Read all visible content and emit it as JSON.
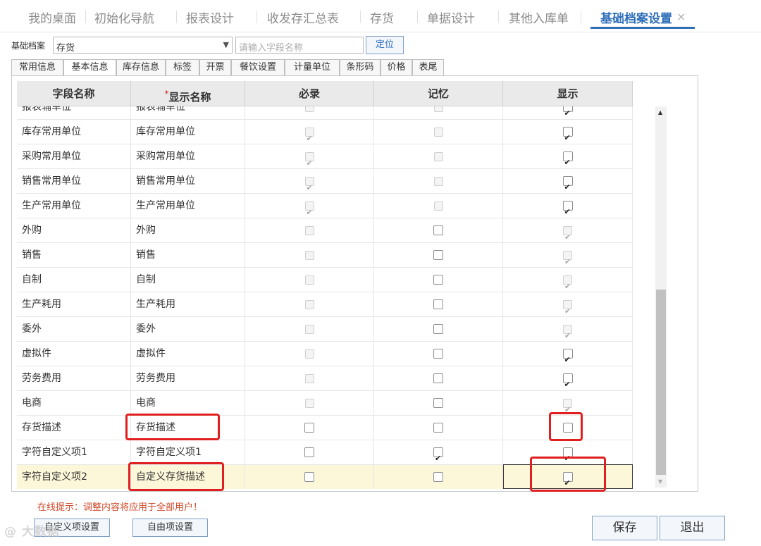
{
  "top_tabs": [
    {
      "label": "我的桌面"
    },
    {
      "label": "初始化导航"
    },
    {
      "label": "报表设计"
    },
    {
      "label": "收发存汇总表"
    },
    {
      "label": "存货"
    },
    {
      "label": "单据设计"
    },
    {
      "label": "其他入库单"
    },
    {
      "label": "基础档案设置",
      "active": true
    }
  ],
  "close_symbol": "×",
  "toolbar": {
    "basic_label": "基础档案",
    "selected_archive": "存货",
    "search_placeholder": "请输入字段名称",
    "locate_label": "定位"
  },
  "sub_tabs": [
    {
      "label": "常用信息"
    },
    {
      "label": "基本信息",
      "active": true
    },
    {
      "label": "库存信息"
    },
    {
      "label": "标签"
    },
    {
      "label": "开票"
    },
    {
      "label": "餐饮设置"
    },
    {
      "label": "计量单位"
    },
    {
      "label": "条形码"
    },
    {
      "label": "价格"
    },
    {
      "label": "表尾"
    }
  ],
  "grid": {
    "headers": {
      "field_name": "字段名称",
      "required_star": "*",
      "display_name": "显示名称",
      "required": "必录",
      "memory": "记忆",
      "show": "显示"
    },
    "rows": [
      {
        "field": "报表辅单位",
        "display": "报表辅单位",
        "required": false,
        "required_enabled": false,
        "memory": false,
        "memory_enabled": false,
        "show": true,
        "show_enabled": true,
        "partial": true
      },
      {
        "field": "库存常用单位",
        "display": "库存常用单位",
        "required": true,
        "required_enabled": false,
        "memory": false,
        "memory_enabled": false,
        "show": true,
        "show_enabled": true
      },
      {
        "field": "采购常用单位",
        "display": "采购常用单位",
        "required": true,
        "required_enabled": false,
        "memory": false,
        "memory_enabled": false,
        "show": true,
        "show_enabled": true
      },
      {
        "field": "销售常用单位",
        "display": "销售常用单位",
        "required": true,
        "required_enabled": false,
        "memory": false,
        "memory_enabled": false,
        "show": true,
        "show_enabled": true
      },
      {
        "field": "生产常用单位",
        "display": "生产常用单位",
        "required": true,
        "required_enabled": false,
        "memory": false,
        "memory_enabled": false,
        "show": true,
        "show_enabled": true
      },
      {
        "field": "外购",
        "display": "外购",
        "required": false,
        "required_enabled": false,
        "memory": false,
        "memory_enabled": true,
        "show": true,
        "show_enabled": false
      },
      {
        "field": "销售",
        "display": "销售",
        "required": false,
        "required_enabled": false,
        "memory": false,
        "memory_enabled": true,
        "show": true,
        "show_enabled": false
      },
      {
        "field": "自制",
        "display": "自制",
        "required": false,
        "required_enabled": false,
        "memory": false,
        "memory_enabled": true,
        "show": true,
        "show_enabled": false
      },
      {
        "field": "生产耗用",
        "display": "生产耗用",
        "required": false,
        "required_enabled": false,
        "memory": false,
        "memory_enabled": true,
        "show": true,
        "show_enabled": false
      },
      {
        "field": "委外",
        "display": "委外",
        "required": false,
        "required_enabled": false,
        "memory": false,
        "memory_enabled": true,
        "show": true,
        "show_enabled": false
      },
      {
        "field": "虚拟件",
        "display": "虚拟件",
        "required": false,
        "required_enabled": false,
        "memory": false,
        "memory_enabled": true,
        "show": true,
        "show_enabled": true
      },
      {
        "field": "劳务费用",
        "display": "劳务费用",
        "required": false,
        "required_enabled": false,
        "memory": false,
        "memory_enabled": true,
        "show": true,
        "show_enabled": true
      },
      {
        "field": "电商",
        "display": "电商",
        "required": false,
        "required_enabled": false,
        "memory": false,
        "memory_enabled": true,
        "show": true,
        "show_enabled": false
      },
      {
        "field": "存货描述",
        "display": "存货描述",
        "required": false,
        "required_enabled": true,
        "memory": false,
        "memory_enabled": true,
        "show": false,
        "show_enabled": true
      },
      {
        "field": "字符自定义项1",
        "display": "字符自定义项1",
        "required": false,
        "required_enabled": true,
        "memory": true,
        "memory_enabled": true,
        "show": true,
        "show_enabled": true
      },
      {
        "field": "字符自定义项2",
        "display": "自定义存货描述",
        "required": false,
        "required_enabled": true,
        "memory": false,
        "memory_enabled": true,
        "show": true,
        "show_enabled": true,
        "selected": true
      }
    ]
  },
  "hint": "在线提示：调整内容将应用于全部用户！",
  "buttons": {
    "custom_item": "自定义项设置",
    "free_item": "自由项设置",
    "save": "保存",
    "exit": "退出"
  },
  "watermark": "@ 大数据"
}
